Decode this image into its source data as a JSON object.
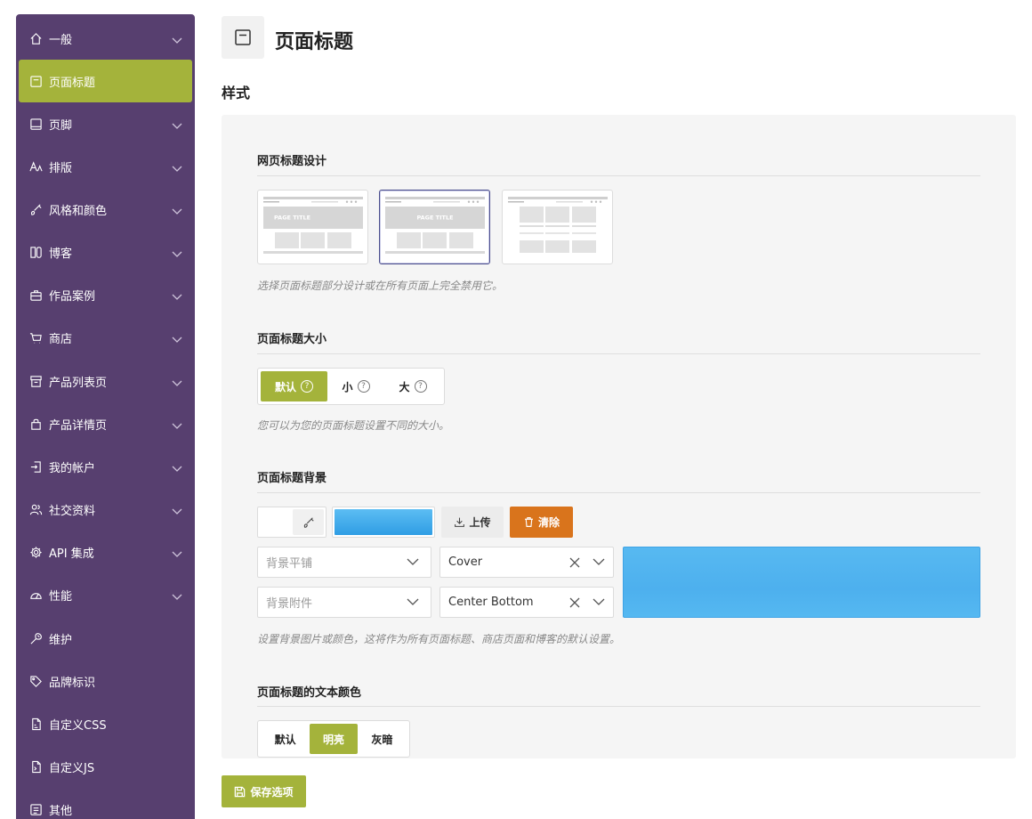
{
  "sidebar": {
    "items": [
      {
        "label": "一般",
        "icon": "home-icon",
        "chevron": true
      },
      {
        "label": "页面标题",
        "icon": "page-title-icon",
        "chevron": false,
        "active": true
      },
      {
        "label": "页脚",
        "icon": "footer-icon",
        "chevron": true
      },
      {
        "label": "排版",
        "icon": "typography-icon",
        "chevron": true
      },
      {
        "label": "风格和颜色",
        "icon": "brush-icon",
        "chevron": true
      },
      {
        "label": "博客",
        "icon": "blog-icon",
        "chevron": true
      },
      {
        "label": "作品案例",
        "icon": "portfolio-icon",
        "chevron": true
      },
      {
        "label": "商店",
        "icon": "cart-icon",
        "chevron": true
      },
      {
        "label": "产品列表页",
        "icon": "archive-icon",
        "chevron": true
      },
      {
        "label": "产品详情页",
        "icon": "bag-icon",
        "chevron": true
      },
      {
        "label": "我的帐户",
        "icon": "login-icon",
        "chevron": true
      },
      {
        "label": "社交资料",
        "icon": "users-icon",
        "chevron": true
      },
      {
        "label": "API 集成",
        "icon": "gear-icon",
        "chevron": true
      },
      {
        "label": "性能",
        "icon": "gauge-icon",
        "chevron": true
      },
      {
        "label": "维护",
        "icon": "wrench-icon",
        "chevron": false
      },
      {
        "label": "品牌标识",
        "icon": "tag-icon",
        "chevron": false
      },
      {
        "label": "自定义CSS",
        "icon": "css-file-icon",
        "chevron": false
      },
      {
        "label": "自定义JS",
        "icon": "js-file-icon",
        "chevron": false
      },
      {
        "label": "其他",
        "icon": "misc-icon",
        "chevron": false
      }
    ]
  },
  "header": {
    "title": "页面标题",
    "icon": "page-title-icon"
  },
  "section": {
    "title": "样式"
  },
  "design": {
    "title": "网页标题设计",
    "preview_text": "PAGE TITLE",
    "selected_index": 1,
    "description": "选择页面标题部分设计或在所有页面上完全禁用它。"
  },
  "size": {
    "title": "页面标题大小",
    "options": [
      "默认",
      "小",
      "大"
    ],
    "help_glyph": "?",
    "selected": "默认",
    "description": "您可以为您的页面标题设置不同的大小。"
  },
  "background": {
    "title": "页面标题背景",
    "upload_label": "上传",
    "clear_label": "清除",
    "repeat_placeholder": "背景平铺",
    "attachment_placeholder": "背景附件",
    "size_value": "Cover",
    "position_value": "Center Bottom",
    "preview_color": "#53b7f0",
    "clear_color": "#d9741c",
    "description": "设置背景图片或颜色，这将作为所有页面标题、商店页面和博客的默认设置。"
  },
  "text_color": {
    "title": "页面标题的文本颜色",
    "options": [
      "默认",
      "明亮",
      "灰暗"
    ],
    "selected": "明亮"
  },
  "save": {
    "label": "保存选项"
  },
  "colors": {
    "sidebar": "#573f6f",
    "accent": "#a4b33b"
  }
}
